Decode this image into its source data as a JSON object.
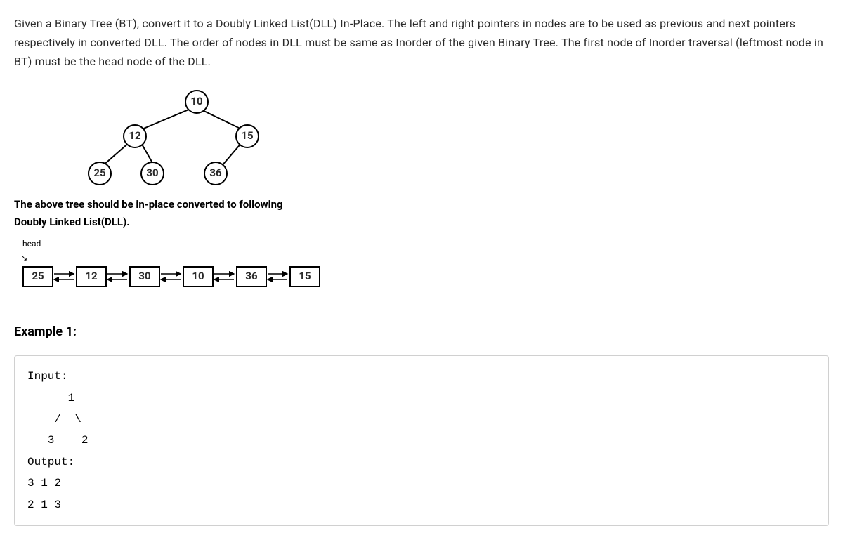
{
  "description": "Given a Binary Tree (BT), convert it to a Doubly Linked List(DLL) In-Place. The left and right pointers in nodes are to be used as previous and next pointers respectively in converted DLL. The order of nodes in DLL must be same as Inorder of the given Binary Tree. The first node of Inorder traversal (leftmost node in BT) must be the head node of the DLL.",
  "tree": {
    "root": "10",
    "left": "12",
    "right": "15",
    "leftleft": "25",
    "leftright": "30",
    "rightleft": "36"
  },
  "caption_line1": "The above tree should be in-place converted to following",
  "caption_line2": "Doubly Linked List(DLL).",
  "head_label": "head",
  "dll": [
    "25",
    "12",
    "30",
    "10",
    "36",
    "15"
  ],
  "example_heading": "Example 1:",
  "code": "Input:\n      1\n    /  \\\n   3    2\nOutput:\n3 1 2\n2 1 3"
}
